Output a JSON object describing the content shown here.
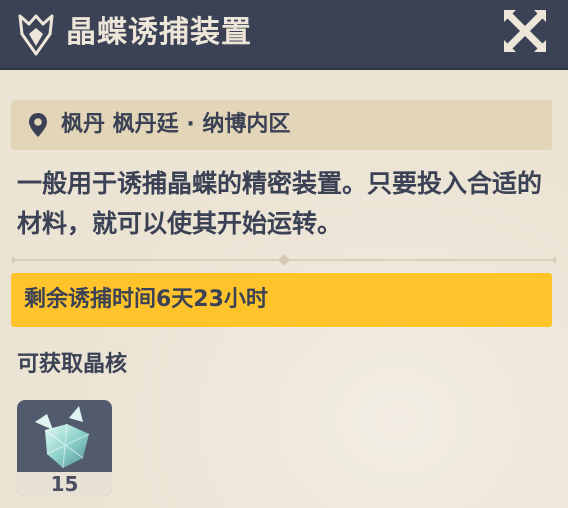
{
  "header": {
    "title": "晶蝶诱捕装置",
    "icon": "butterfly-emblem-icon",
    "close_icon": "close-x-icon"
  },
  "location": {
    "icon": "map-pin-icon",
    "text": "枫丹 枫丹廷 · 纳博内区"
  },
  "description": "一般用于诱捕晶蝶的精密装置。只要投入合适的材料，就可以使其开始运转。",
  "timer": {
    "text": "剩余诱捕时间6天23小时",
    "color": "#ffc42c"
  },
  "obtainable": {
    "title": "可获取晶核",
    "items": [
      {
        "icon": "crystal-core-icon",
        "count": "15"
      }
    ]
  },
  "colors": {
    "header_bg": "#3b4255",
    "panel_bg": "#ebe3d3",
    "text": "#3b4255"
  }
}
